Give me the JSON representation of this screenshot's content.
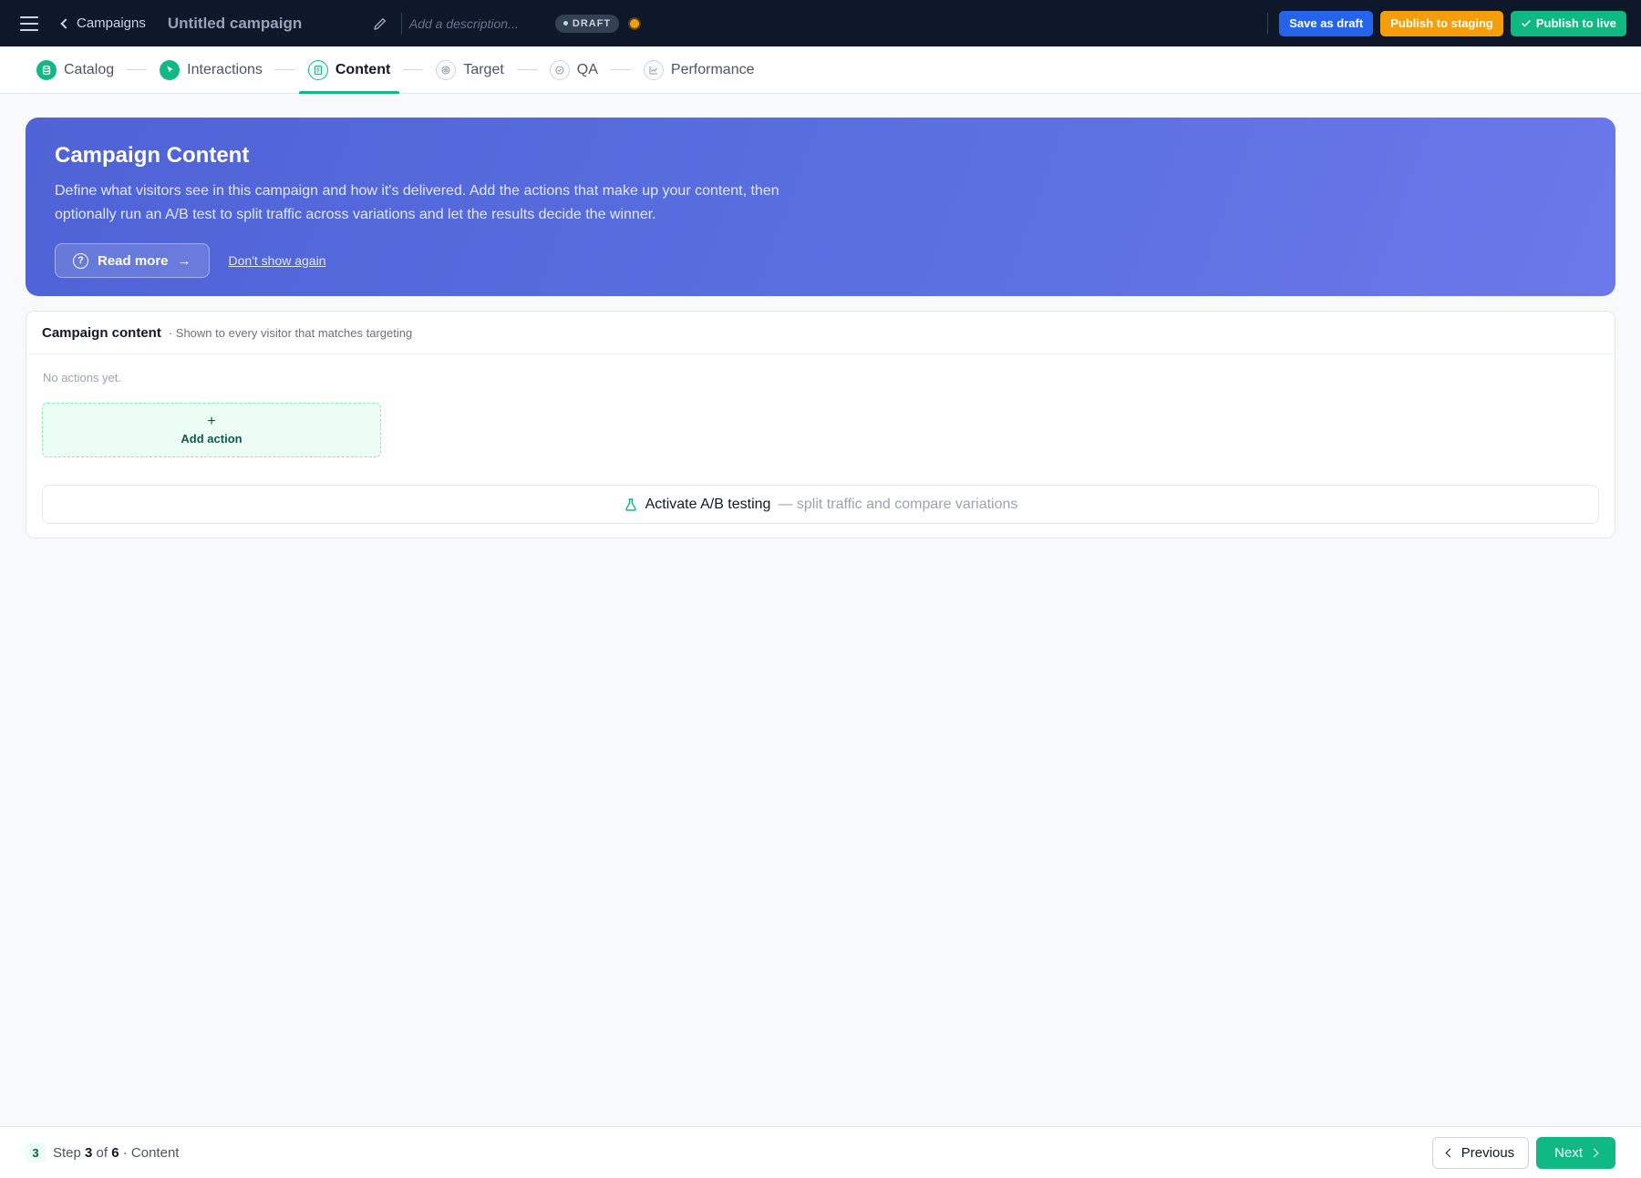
{
  "topbar": {
    "back_label": "Campaigns",
    "campaign_title": "Untitled campaign",
    "description_placeholder": "Add a description...",
    "status_badge": "DRAFT",
    "status_dot_color": "#f59e0b",
    "save_draft_label": "Save as draft",
    "publish_staging_label": "Publish to staging",
    "publish_live_label": "Publish to live"
  },
  "stepper": {
    "steps": [
      {
        "label": "Catalog",
        "state": "done",
        "icon": "database-icon"
      },
      {
        "label": "Interactions",
        "state": "done",
        "icon": "cursor-icon"
      },
      {
        "label": "Content",
        "state": "current",
        "icon": "document-icon"
      },
      {
        "label": "Target",
        "state": "pending",
        "icon": "target-icon"
      },
      {
        "label": "QA",
        "state": "pending",
        "icon": "check-circle-icon"
      },
      {
        "label": "Performance",
        "state": "pending",
        "icon": "chart-icon"
      }
    ]
  },
  "hero": {
    "title": "Campaign Content",
    "body": "Define what visitors see in this campaign and how it's delivered. Add the actions that make up your content, then optionally run an A/B test to split traffic across variations and let the results decide the winner.",
    "read_more_label": "Read more",
    "dont_show_label": "Don't show again"
  },
  "content_card": {
    "title": "Campaign content",
    "subtitle": "· Shown to every visitor that matches targeting",
    "empty_text": "No actions yet.",
    "add_action_plus": "+",
    "add_action_label": "Add action",
    "ab_label": "Activate A/B testing",
    "ab_sublabel": "— split traffic and compare variations"
  },
  "footer": {
    "step_badge": "3",
    "step_word": "Step",
    "step_current": "3",
    "step_of": "of",
    "step_total": "6",
    "step_name": "· Content",
    "previous_label": "Previous",
    "next_label": "Next"
  },
  "colors": {
    "accent_green": "#10b981",
    "accent_blue": "#2563eb",
    "accent_orange": "#f59e0b",
    "topbar_bg": "#0f172a",
    "hero_start": "#4f63d6",
    "hero_end": "#6b78ea"
  }
}
